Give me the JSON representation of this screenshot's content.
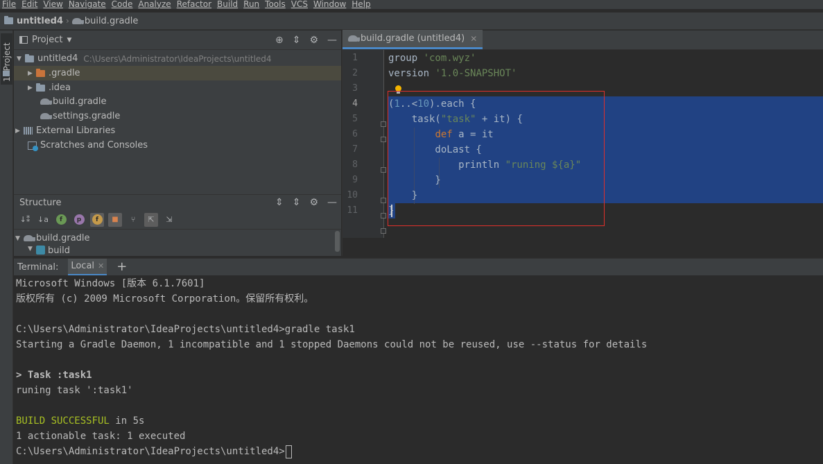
{
  "menu": [
    "File",
    "Edit",
    "View",
    "Navigate",
    "Code",
    "Analyze",
    "Refactor",
    "Build",
    "Run",
    "Tools",
    "VCS",
    "Window",
    "Help"
  ],
  "breadcrumb": {
    "project": "untitled4",
    "file": "build.gradle"
  },
  "left_stripe": {
    "project_tab": "1: Project"
  },
  "project_panel": {
    "title": "Project",
    "tree": [
      {
        "label": "untitled4",
        "hint": "C:\\Users\\Administrator\\IdeaProjects\\untitled4"
      },
      {
        "label": ".gradle"
      },
      {
        "label": ".idea"
      },
      {
        "label": "build.gradle"
      },
      {
        "label": "settings.gradle"
      },
      {
        "label": "External Libraries"
      },
      {
        "label": "Scratches and Consoles"
      }
    ]
  },
  "structure_panel": {
    "title": "Structure",
    "tree": [
      {
        "label": "build.gradle"
      },
      {
        "label": "build"
      }
    ]
  },
  "editor": {
    "tab_label": "build.gradle (untitled4)",
    "line_numbers": [
      "1",
      "2",
      "3",
      "4",
      "5",
      "6",
      "7",
      "8",
      "9",
      "10",
      "11"
    ],
    "current_line": 4
  },
  "terminal": {
    "title": "Terminal:",
    "tab_label": "Local",
    "lines": [
      "Microsoft Windows [版本 6.1.7601]",
      "版权所有 (c) 2009 Microsoft Corporation。保留所有权利。",
      "",
      "C:\\Users\\Administrator\\IdeaProjects\\untitled4>gradle task1",
      "Starting a Gradle Daemon, 1 incompatible and 1 stopped Daemons could not be reused, use --status for details",
      "",
      "> Task :task1",
      "runing task ':task1'",
      "",
      "BUILD SUCCESSFUL",
      "1 actionable task: 1 executed",
      "C:\\Users\\Administrator\\IdeaProjects\\untitled4>"
    ],
    "build_time": " in 5s"
  },
  "colors": {
    "background": "#2b2b2b",
    "panel": "#3c3f41",
    "selection": "#214283",
    "accent": "#4a88c7",
    "highlight_box": "#e0302b",
    "success": "#a8c023"
  }
}
